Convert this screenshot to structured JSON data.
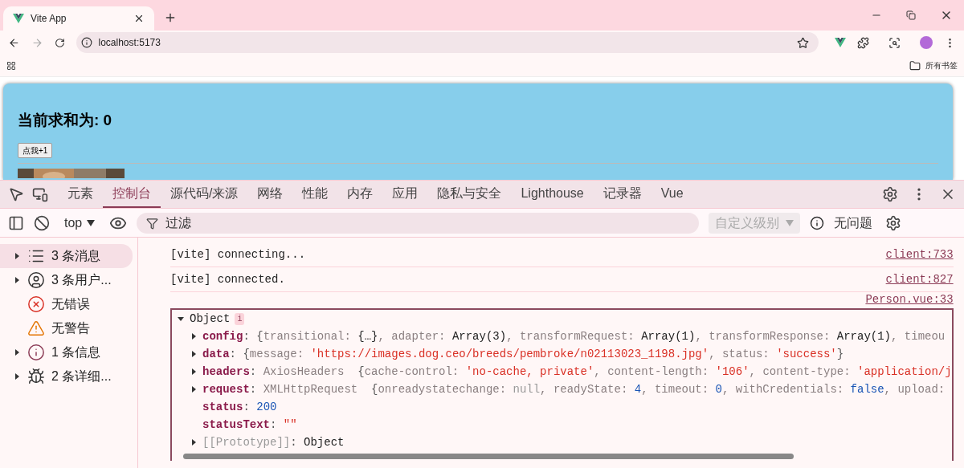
{
  "browser": {
    "tabs": [
      {
        "title": "Vite App",
        "selected": true
      }
    ],
    "address": "localhost:5173",
    "bookmarks_folder": "所有书签"
  },
  "page": {
    "heading": "当前求和为: 0",
    "button": "点我+1"
  },
  "devtools": {
    "tabs": [
      {
        "label": "元素",
        "selected": false
      },
      {
        "label": "控制台",
        "selected": true
      },
      {
        "label": "源代码/来源",
        "selected": false
      },
      {
        "label": "网络",
        "selected": false
      },
      {
        "label": "性能",
        "selected": false
      },
      {
        "label": "内存",
        "selected": false
      },
      {
        "label": "应用",
        "selected": false
      },
      {
        "label": "隐私与安全",
        "selected": false
      },
      {
        "label": "Lighthouse",
        "selected": false
      },
      {
        "label": "记录器",
        "selected": false
      },
      {
        "label": "Vue",
        "selected": false
      }
    ],
    "console_toolbar": {
      "context": "top",
      "filter_placeholder": "过滤",
      "levels": "自定义级别",
      "issues": "无问题"
    },
    "sidebar": [
      {
        "kind": "list",
        "label": "3 条消息",
        "expandable": true,
        "selected": true
      },
      {
        "kind": "user",
        "label": "3 条用户...",
        "expandable": true,
        "selected": false
      },
      {
        "kind": "error",
        "label": "无错误",
        "expandable": false,
        "selected": false
      },
      {
        "kind": "warning",
        "label": "无警告",
        "expandable": false,
        "selected": false
      },
      {
        "kind": "info",
        "label": "1 条信息",
        "expandable": true,
        "selected": false
      },
      {
        "kind": "bug",
        "label": "2 条详细...",
        "expandable": true,
        "selected": false
      }
    ],
    "messages": [
      {
        "text": "[vite] connecting...",
        "source": "client:733"
      },
      {
        "text": "[vite] connected.",
        "source": "client:827"
      }
    ],
    "object_entry": {
      "source": "Person.vue:33",
      "label": "Object",
      "badge": "i",
      "expanded": true,
      "properties": [
        {
          "name": "config",
          "internal": false,
          "expandable": true,
          "parts": [
            {
              "kind": "punct",
              "text": ": {"
            },
            {
              "kind": "key",
              "text": "transitional: "
            },
            {
              "kind": "plain",
              "text": "{…}"
            },
            {
              "kind": "key",
              "text": ", adapter: "
            },
            {
              "kind": "plain",
              "text": "Array(3)"
            },
            {
              "kind": "key",
              "text": ", transformRequest: "
            },
            {
              "kind": "plain",
              "text": "Array(1)"
            },
            {
              "kind": "key",
              "text": ", transformResponse: "
            },
            {
              "kind": "plain",
              "text": "Array(1)"
            },
            {
              "kind": "key",
              "text": ", timeou"
            }
          ]
        },
        {
          "name": "data",
          "internal": false,
          "expandable": true,
          "parts": [
            {
              "kind": "punct",
              "text": ": {"
            },
            {
              "kind": "key",
              "text": "message: "
            },
            {
              "kind": "string",
              "text": "'https://images.dog.ceo/breeds/pembroke/n02113023_1198.jpg'"
            },
            {
              "kind": "key",
              "text": ", status: "
            },
            {
              "kind": "string",
              "text": "'success'"
            },
            {
              "kind": "punct",
              "text": "}"
            }
          ]
        },
        {
          "name": "headers",
          "internal": false,
          "expandable": true,
          "parts": [
            {
              "kind": "punct",
              "text": ": "
            },
            {
              "kind": "key",
              "text": "AxiosHeaders  "
            },
            {
              "kind": "punct",
              "text": "{"
            },
            {
              "kind": "key",
              "text": "cache-control: "
            },
            {
              "kind": "string",
              "text": "'no-cache, private'"
            },
            {
              "kind": "key",
              "text": ", content-length: "
            },
            {
              "kind": "string",
              "text": "'106'"
            },
            {
              "kind": "key",
              "text": ", content-type: "
            },
            {
              "kind": "string",
              "text": "'application/j"
            }
          ]
        },
        {
          "name": "request",
          "internal": false,
          "expandable": true,
          "parts": [
            {
              "kind": "punct",
              "text": ": "
            },
            {
              "kind": "key",
              "text": "XMLHttpRequest  "
            },
            {
              "kind": "punct",
              "text": "{"
            },
            {
              "kind": "key",
              "text": "onreadystatechange: "
            },
            {
              "kind": "null",
              "text": "null"
            },
            {
              "kind": "key",
              "text": ", readyState: "
            },
            {
              "kind": "number",
              "text": "4"
            },
            {
              "kind": "key",
              "text": ", timeout: "
            },
            {
              "kind": "number",
              "text": "0"
            },
            {
              "kind": "key",
              "text": ", withCredentials: "
            },
            {
              "kind": "number",
              "text": "false"
            },
            {
              "kind": "key",
              "text": ", upload:"
            }
          ]
        },
        {
          "name": "status",
          "internal": false,
          "expandable": false,
          "parts": [
            {
              "kind": "punct",
              "text": ": "
            },
            {
              "kind": "number",
              "text": "200"
            }
          ]
        },
        {
          "name": "statusText",
          "internal": false,
          "expandable": false,
          "parts": [
            {
              "kind": "punct",
              "text": ": "
            },
            {
              "kind": "string",
              "text": "\"\""
            }
          ]
        },
        {
          "name": "[[Prototype]]",
          "internal": true,
          "expandable": true,
          "parts": [
            {
              "kind": "punct",
              "text": ": "
            },
            {
              "kind": "plain",
              "text": "Object"
            }
          ]
        }
      ]
    }
  }
}
